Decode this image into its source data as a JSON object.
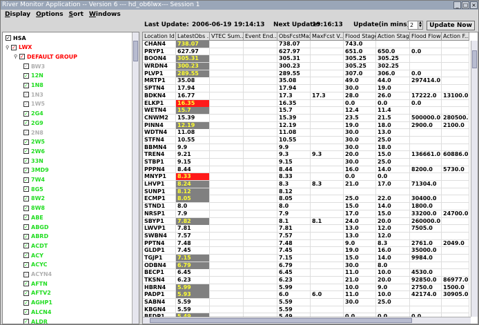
{
  "window": {
    "title": "River Monitor Application -- Version 6 --- hd_ob6lwx--- Session 1"
  },
  "menu": [
    "Display",
    "Options",
    "Sort",
    "Windows"
  ],
  "status": {
    "last_update_label": "Last Update:",
    "last_update_value": "2006-06-19 19:14:13",
    "next_update_label": "Next Update:",
    "next_update_value": "19:16:13",
    "interval_label": "Update(in mins)",
    "interval_value": "2",
    "update_now": "Update Now"
  },
  "tree": [
    {
      "label": "HSA",
      "level": 0,
      "color": "#000000",
      "handle": ""
    },
    {
      "label": "LWX",
      "level": 1,
      "color": "#ff0000",
      "handle": "o"
    },
    {
      "label": "DEFAULT GROUP",
      "level": 2,
      "color": "#ff0000",
      "handle": "o"
    },
    {
      "label": "BW3",
      "level": 3,
      "color": "#b0b0b0",
      "handle": ""
    },
    {
      "label": "12N",
      "level": 3,
      "color": "#22dd22",
      "handle": ""
    },
    {
      "label": "1N8",
      "level": 3,
      "color": "#22dd22",
      "handle": ""
    },
    {
      "label": "1N3",
      "level": 3,
      "color": "#b0b0b0",
      "handle": ""
    },
    {
      "label": "1W5",
      "level": 3,
      "color": "#b0b0b0",
      "handle": ""
    },
    {
      "label": "2G4",
      "level": 3,
      "color": "#22dd22",
      "handle": ""
    },
    {
      "label": "2G9",
      "level": 3,
      "color": "#22dd22",
      "handle": ""
    },
    {
      "label": "2N8",
      "level": 3,
      "color": "#b0b0b0",
      "handle": ""
    },
    {
      "label": "2W5",
      "level": 3,
      "color": "#22dd22",
      "handle": ""
    },
    {
      "label": "2W6",
      "level": 3,
      "color": "#22dd22",
      "handle": ""
    },
    {
      "label": "33N",
      "level": 3,
      "color": "#22dd22",
      "handle": ""
    },
    {
      "label": "3MD9",
      "level": 3,
      "color": "#22dd22",
      "handle": ""
    },
    {
      "label": "7W4",
      "level": 3,
      "color": "#22dd22",
      "handle": ""
    },
    {
      "label": "8G5",
      "level": 3,
      "color": "#22dd22",
      "handle": ""
    },
    {
      "label": "8W2",
      "level": 3,
      "color": "#22dd22",
      "handle": ""
    },
    {
      "label": "8W8",
      "level": 3,
      "color": "#22dd22",
      "handle": ""
    },
    {
      "label": "ABE",
      "level": 3,
      "color": "#22dd22",
      "handle": ""
    },
    {
      "label": "ABGD",
      "level": 3,
      "color": "#22dd22",
      "handle": ""
    },
    {
      "label": "ABRD",
      "level": 3,
      "color": "#22dd22",
      "handle": ""
    },
    {
      "label": "ACDT",
      "level": 3,
      "color": "#22dd22",
      "handle": ""
    },
    {
      "label": "ACY",
      "level": 3,
      "color": "#22dd22",
      "handle": ""
    },
    {
      "label": "ACYC",
      "level": 3,
      "color": "#22dd22",
      "handle": ""
    },
    {
      "label": "ACYN4",
      "level": 3,
      "color": "#b0b0b0",
      "handle": ""
    },
    {
      "label": "AFTN",
      "level": 3,
      "color": "#22dd22",
      "handle": ""
    },
    {
      "label": "AFTV2",
      "level": 3,
      "color": "#22dd22",
      "handle": ""
    },
    {
      "label": "AGHP1",
      "level": 3,
      "color": "#22dd22",
      "handle": ""
    },
    {
      "label": "ALCN4",
      "level": 3,
      "color": "#22dd22",
      "handle": ""
    },
    {
      "label": "ALDR",
      "level": 3,
      "color": "#22dd22",
      "handle": ""
    }
  ],
  "table": {
    "columns": [
      "Location Id",
      "LatestObs ...",
      "VTEC Sum...",
      "Event End...",
      "ObsFcstMax",
      "MaxFcst V...",
      "Flood Stage",
      "Action Stage",
      "Flood Flow",
      "Action F..."
    ],
    "rows": [
      {
        "cells": [
          "CHAN4",
          "738.07",
          "",
          "",
          "738.07",
          "",
          "743.0",
          "",
          "",
          ""
        ],
        "hl": "yellow"
      },
      {
        "cells": [
          "PRYP1",
          "627.97",
          "",
          "",
          "627.97",
          "",
          "651.0",
          "650.0",
          "0.0",
          ""
        ],
        "hl": ""
      },
      {
        "cells": [
          "BOON4",
          "305.31",
          "",
          "",
          "305.31",
          "",
          "305.25",
          "305.25",
          "",
          ""
        ],
        "hl": "yellow"
      },
      {
        "cells": [
          "WRDN4",
          "300.23",
          "",
          "",
          "300.23",
          "",
          "305.25",
          "302.25",
          "",
          ""
        ],
        "hl": "yellow"
      },
      {
        "cells": [
          "PLVP1",
          "289.55",
          "",
          "",
          "289.55",
          "",
          "307.0",
          "306.0",
          "0.0",
          ""
        ],
        "hl": "yellow"
      },
      {
        "cells": [
          "MRTP1",
          "35.08",
          "",
          "",
          "35.08",
          "",
          "49.0",
          "44.0",
          "297414.0",
          ""
        ],
        "hl": ""
      },
      {
        "cells": [
          "SPTN4",
          "17.94",
          "",
          "",
          "17.94",
          "",
          "30.0",
          "19.0",
          "",
          ""
        ],
        "hl": ""
      },
      {
        "cells": [
          "BDKN4",
          "16.77",
          "",
          "",
          "17.3",
          "17.3",
          "28.0",
          "26.0",
          "17222.0",
          "13100.0"
        ],
        "hl": ""
      },
      {
        "cells": [
          "ELKP1",
          "16.35",
          "",
          "",
          "16.35",
          "",
          "0.0",
          "0.0",
          "0.0",
          ""
        ],
        "hl": "red"
      },
      {
        "cells": [
          "WETN4",
          "15.7",
          "",
          "",
          "15.7",
          "",
          "12.4",
          "11.4",
          "",
          ""
        ],
        "hl": "yellow"
      },
      {
        "cells": [
          "CNWM2",
          "15.39",
          "",
          "",
          "15.39",
          "",
          "23.5",
          "21.5",
          "500000.0",
          "280500.0"
        ],
        "hl": ""
      },
      {
        "cells": [
          "PINN4",
          "12.19",
          "",
          "",
          "12.19",
          "",
          "19.0",
          "18.0",
          "2900.0",
          "2100.0"
        ],
        "hl": "yellow"
      },
      {
        "cells": [
          "WDTN4",
          "11.08",
          "",
          "",
          "11.08",
          "",
          "30.0",
          "13.0",
          "",
          ""
        ],
        "hl": ""
      },
      {
        "cells": [
          "STFN4",
          "10.55",
          "",
          "",
          "10.55",
          "",
          "30.0",
          "25.0",
          "",
          ""
        ],
        "hl": ""
      },
      {
        "cells": [
          "BBMN4",
          "9.9",
          "",
          "",
          "9.9",
          "",
          "30.0",
          "18.0",
          "",
          ""
        ],
        "hl": ""
      },
      {
        "cells": [
          "TREN4",
          "9.21",
          "",
          "",
          "9.3",
          "9.3",
          "20.0",
          "15.0",
          "136661.0",
          "60886.0"
        ],
        "hl": ""
      },
      {
        "cells": [
          "STBP1",
          "9.15",
          "",
          "",
          "9.15",
          "",
          "30.0",
          "25.0",
          "",
          ""
        ],
        "hl": ""
      },
      {
        "cells": [
          "PPPN4",
          "8.44",
          "",
          "",
          "8.44",
          "",
          "16.0",
          "14.0",
          "8200.0",
          "5730.0"
        ],
        "hl": ""
      },
      {
        "cells": [
          "MNYP1",
          "8.33",
          "",
          "",
          "8.33",
          "",
          "0.0",
          "0.0",
          "",
          ""
        ],
        "hl": "red"
      },
      {
        "cells": [
          "LHVP1",
          "8.24",
          "",
          "",
          "8.3",
          "8.3",
          "21.0",
          "17.0",
          "71304.0",
          ""
        ],
        "hl": "yellow"
      },
      {
        "cells": [
          "SUNP1",
          "8.12",
          "",
          "",
          "8.12",
          "",
          "",
          "",
          "",
          ""
        ],
        "hl": "yellow"
      },
      {
        "cells": [
          "ECMP1",
          "8.05",
          "",
          "",
          "8.05",
          "",
          "25.0",
          "22.0",
          "30400.0",
          ""
        ],
        "hl": "yellow"
      },
      {
        "cells": [
          "STND1",
          "8.0",
          "",
          "",
          "8.0",
          "",
          "15.0",
          "14.0",
          "1800.0",
          ""
        ],
        "hl": ""
      },
      {
        "cells": [
          "NRSP1",
          "7.9",
          "",
          "",
          "7.9",
          "",
          "17.0",
          "15.0",
          "33200.0",
          "24700.0"
        ],
        "hl": ""
      },
      {
        "cells": [
          "SBYP1",
          "7.82",
          "",
          "",
          "8.1",
          "8.1",
          "24.0",
          "20.0",
          "260000.0",
          ""
        ],
        "hl": "yellow"
      },
      {
        "cells": [
          "LWVP1",
          "7.81",
          "",
          "",
          "7.81",
          "",
          "13.0",
          "12.0",
          "7505.0",
          ""
        ],
        "hl": ""
      },
      {
        "cells": [
          "SWBN4",
          "7.57",
          "",
          "",
          "7.57",
          "",
          "13.0",
          "12.0",
          "",
          ""
        ],
        "hl": ""
      },
      {
        "cells": [
          "PPTN4",
          "7.48",
          "",
          "",
          "7.48",
          "",
          "9.0",
          "8.3",
          "2761.0",
          "2049.0"
        ],
        "hl": ""
      },
      {
        "cells": [
          "GLDP1",
          "7.45",
          "",
          "",
          "7.45",
          "",
          "19.0",
          "16.0",
          "35000.0",
          ""
        ],
        "hl": ""
      },
      {
        "cells": [
          "TGJP1",
          "7.15",
          "",
          "",
          "7.15",
          "",
          "15.0",
          "14.0",
          "9984.0",
          ""
        ],
        "hl": "yellow"
      },
      {
        "cells": [
          "ODBN4",
          "6.79",
          "",
          "",
          "6.79",
          "",
          "30.0",
          "8.0",
          "",
          ""
        ],
        "hl": "yellow"
      },
      {
        "cells": [
          "BECP1",
          "6.45",
          "",
          "",
          "6.45",
          "",
          "11.0",
          "10.0",
          "4530.0",
          ""
        ],
        "hl": ""
      },
      {
        "cells": [
          "TKSN4",
          "6.23",
          "",
          "",
          "6.23",
          "",
          "21.0",
          "20.0",
          "92850.0",
          "86977.0"
        ],
        "hl": ""
      },
      {
        "cells": [
          "HBRN4",
          "5.99",
          "",
          "",
          "5.99",
          "",
          "10.0",
          "9.0",
          "2750.0",
          "1500.0"
        ],
        "hl": "yellow"
      },
      {
        "cells": [
          "PADP1",
          "5.93",
          "",
          "",
          "6.0",
          "6.0",
          "11.0",
          "10.0",
          "42174.0",
          "30905.0"
        ],
        "hl": "yellow"
      },
      {
        "cells": [
          "SABN4",
          "5.59",
          "",
          "",
          "5.59",
          "",
          "30.0",
          "25.0",
          "",
          ""
        ],
        "hl": ""
      },
      {
        "cells": [
          "KBGN4",
          "5.59",
          "",
          "",
          "5.59",
          "",
          "",
          "",
          "",
          ""
        ],
        "hl": ""
      },
      {
        "cells": [
          "BEDP1",
          "5.49",
          "",
          "",
          "5.49",
          "",
          "0.0",
          "0.0",
          "0.0",
          ""
        ],
        "hl": "yellow"
      }
    ]
  }
}
